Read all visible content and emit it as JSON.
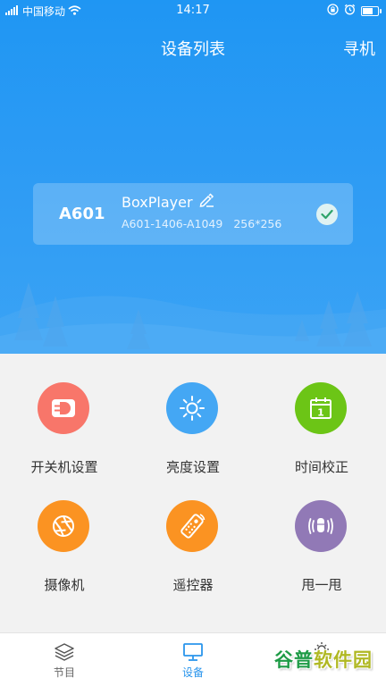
{
  "status_bar": {
    "carrier": "中国移动",
    "time": "14:17",
    "battery_level": 0.7
  },
  "header": {
    "title": "设备列表",
    "scan_label": "寻机"
  },
  "device": {
    "code": "A601",
    "name": "BoxPlayer",
    "serial": "A601-1406-A1049",
    "resolution": "256*256",
    "selected": true
  },
  "features": [
    {
      "label": "开关机设置",
      "icon": "power-plug-icon",
      "color": "#f8766a"
    },
    {
      "label": "亮度设置",
      "icon": "sun-icon",
      "color": "#44a7f4"
    },
    {
      "label": "时间校正",
      "icon": "calendar-icon",
      "color": "#6cc516"
    },
    {
      "label": "摄像机",
      "icon": "camera-aperture-icon",
      "color": "#fb9322"
    },
    {
      "label": "遥控器",
      "icon": "remote-control-icon",
      "color": "#fb9322"
    },
    {
      "label": "甩一甩",
      "icon": "shake-icon",
      "color": "#9179b6"
    }
  ],
  "calendar_day": "1",
  "bottom_nav": {
    "items": [
      {
        "label": "节目",
        "icon": "layers-icon",
        "active": false
      },
      {
        "label": "设备",
        "icon": "monitor-icon",
        "active": true
      },
      {
        "label": "",
        "icon": "settings-icon",
        "active": false
      }
    ]
  },
  "watermark": {
    "part1": "谷普",
    "part2": "软件园"
  },
  "colors": {
    "primary_blue": "#1f96f3",
    "active_tab": "#2a95ec",
    "check_green": "#2ea36a"
  }
}
